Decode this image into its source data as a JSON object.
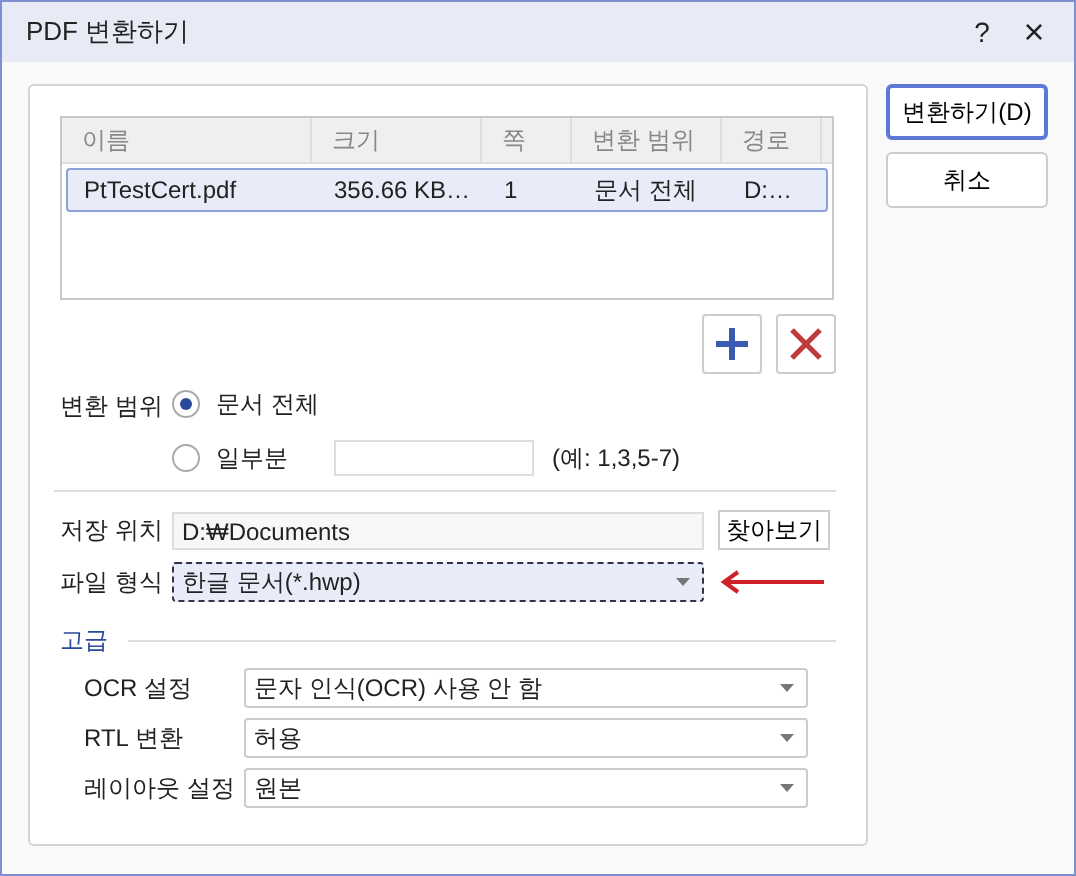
{
  "window": {
    "title": "PDF 변환하기",
    "help": "?",
    "close": "×"
  },
  "table": {
    "columns": [
      "이름",
      "크기",
      "쪽",
      "변환 범위",
      "경로"
    ],
    "rows": [
      {
        "cells": [
          "PtTestCert.pdf",
          "356.66 KB…",
          "1",
          "문서 전체",
          "D:…"
        ],
        "selected": true
      }
    ]
  },
  "range": {
    "label": "변환 범위",
    "options": [
      {
        "label": "문서 전체",
        "selected": true
      },
      {
        "label": "일부분",
        "selected": false
      }
    ],
    "hint": "(예: 1,3,5-7)"
  },
  "save": {
    "label": "저장 위치",
    "value": "D:₩Documents",
    "browse": "찾아보기"
  },
  "format": {
    "label": "파일 형식",
    "value": "한글 문서(*.hwp)",
    "focused": true
  },
  "advanced": {
    "title": "고급",
    "settings": [
      {
        "label": "OCR 설정",
        "value": "문자 인식(OCR) 사용 안 함"
      },
      {
        "label": "RTL 변환",
        "value": "허용"
      },
      {
        "label": "레이아웃 설정",
        "value": "원본"
      }
    ]
  },
  "buttons": [
    {
      "label": "변환하기(D)",
      "default": true
    },
    {
      "label": "취소",
      "default": false
    }
  ]
}
